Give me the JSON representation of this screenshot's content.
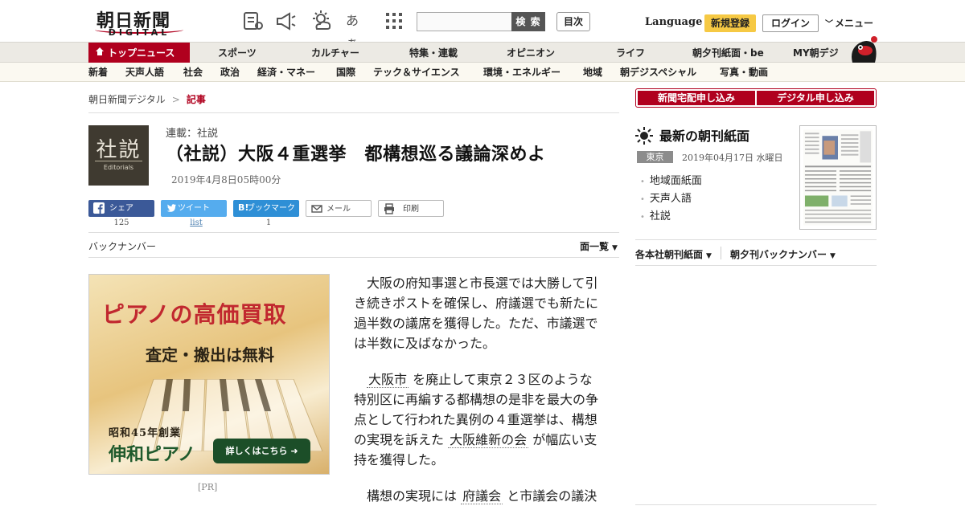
{
  "header": {
    "logo_main": "朝日新聞",
    "logo_sub": "DIGITAL",
    "search_placeholder": "",
    "search_button": "検 索",
    "toc_button": "目次",
    "language": "Language",
    "signup": "新規登録",
    "login": "ログイン",
    "menu": "メニュー",
    "icons": [
      "news-list-icon",
      "megaphone-icon",
      "weather-icon",
      "font-size-icon",
      "grid-icon"
    ],
    "font_size_glyph": "あぁ"
  },
  "main_nav": {
    "top": "トップニュース",
    "items": [
      "スポーツ",
      "カルチャー",
      "特集・連載",
      "オピニオン",
      "ライフ",
      "朝夕刊紙面・be",
      "MY朝デジ"
    ]
  },
  "sub_nav": {
    "items": [
      "新着",
      "天声人語",
      "社会",
      "政治",
      "経済・マネー",
      "国際",
      "テック＆サイエンス",
      "環境・エネルギー",
      "地域",
      "朝デジスペシャル",
      "写真・動画"
    ]
  },
  "breadcrumb": {
    "home": "朝日新聞デジタル",
    "separator": ">",
    "current": "記事"
  },
  "article": {
    "thumb_kanji": "社説",
    "thumb_en": "Editorials",
    "series": "連載：社説",
    "headline": "（社説）大阪４重選挙　都構想巡る議論深めよ",
    "date": "2019年4月8日05時00分",
    "share": {
      "facebook": "シェア",
      "facebook_count": "125",
      "twitter": "ツイート",
      "twitter_count": "list",
      "hatena": "ブックマーク",
      "hatena_icon": "B!",
      "hatena_count": "1",
      "mail": "メール",
      "print": "印刷"
    },
    "back_number": "バックナンバー",
    "page_list": "面一覧",
    "paragraphs": [
      {
        "before": "大阪の府知事選と市長選では大勝して引き続きポストを確保し、府議選でも新たに過半数の議席を獲得した。ただ、市議選では半数に及ばなかった。",
        "kw1": "",
        "mid": "",
        "kw2": "",
        "after": ""
      },
      {
        "before": "",
        "kw1": "大阪市",
        "mid": "を廃止して東京２３区のような特別区に再編する都構想の是非を最大の争点として行われた異例の４重選挙は、構想の実現を訴えた",
        "kw2": "大阪維新の会",
        "after": "が幅広い支持を獲得した。"
      },
      {
        "before": "構想の実現には",
        "kw1": "府議会",
        "mid": "と市議会の議決",
        "kw2": "",
        "after": ""
      }
    ]
  },
  "ad": {
    "title": "ピアノの高価買取",
    "subtitle": "査定・搬出は無料",
    "established": "昭和45年創業",
    "brand": "伸和ピアノ",
    "cta": "詳しくはこちら",
    "pr_label": "[PR]"
  },
  "sidebar": {
    "subscribe_paper": "新聞宅配申し込み",
    "subscribe_digital": "デジタル申し込み",
    "morning_title": "最新の朝刊紙面",
    "edition": "東京",
    "edition_date": "2019年04月17日 水曜日",
    "links": [
      "地域面紙面",
      "天声人語",
      "社説"
    ],
    "dropdown_regional": "各本社朝刊紙面",
    "dropdown_backnumber": "朝夕刊バックナンバー"
  },
  "colors": {
    "brand_red": "#b0001e",
    "signup_yellow": "#f6c944",
    "facebook": "#3b5998",
    "twitter": "#55acee",
    "hatena": "#2e8fd6"
  }
}
